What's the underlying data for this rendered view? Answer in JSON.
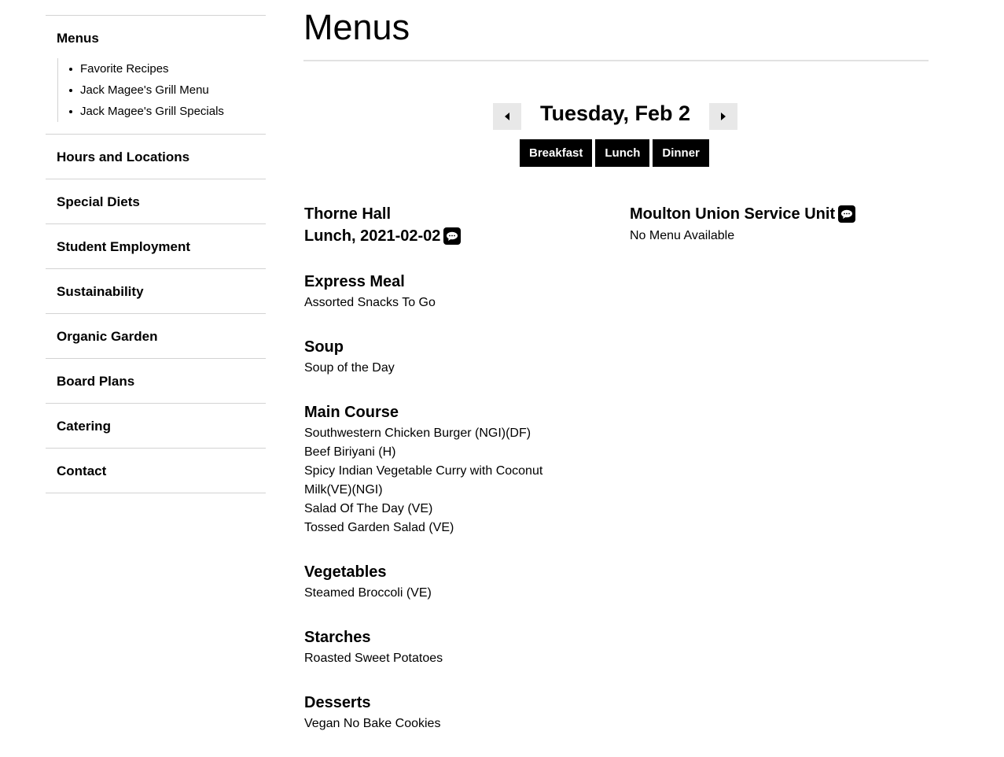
{
  "sidebar": {
    "active": {
      "label": "Menus",
      "items": [
        "Favorite Recipes",
        "Jack Magee's Grill Menu",
        "Jack Magee's Grill Specials"
      ]
    },
    "links": [
      "Hours and Locations",
      "Special Diets",
      "Student Employment",
      "Sustainability",
      "Organic Garden",
      "Board Plans",
      "Catering",
      "Contact"
    ]
  },
  "main": {
    "title": "Menus",
    "date_label": "Tuesday, Feb 2",
    "meals": [
      "Breakfast",
      "Lunch",
      "Dinner"
    ],
    "left_location": {
      "name": "Thorne Hall",
      "subtitle": "Lunch, 2021-02-02",
      "icon": "chat-bubble-icon",
      "stations": [
        {
          "name": "Express Meal",
          "items": [
            "Assorted Snacks To Go"
          ]
        },
        {
          "name": "Soup",
          "items": [
            "Soup of the Day"
          ]
        },
        {
          "name": "Main Course",
          "items": [
            "Southwestern Chicken Burger (NGI)(DF)",
            "Beef Biriyani (H)",
            "Spicy Indian Vegetable Curry with Coconut Milk(VE)(NGI)",
            "Salad Of The Day (VE)",
            "Tossed Garden Salad (VE)"
          ]
        },
        {
          "name": "Vegetables",
          "items": [
            "Steamed Broccoli (VE)"
          ]
        },
        {
          "name": "Starches",
          "items": [
            "Roasted Sweet Potatoes"
          ]
        },
        {
          "name": "Desserts",
          "items": [
            "Vegan No Bake Cookies"
          ]
        }
      ]
    },
    "right_location": {
      "name": "Moulton Union Service Unit",
      "icon": "chat-bubble-icon",
      "status": "No Menu Available"
    }
  }
}
